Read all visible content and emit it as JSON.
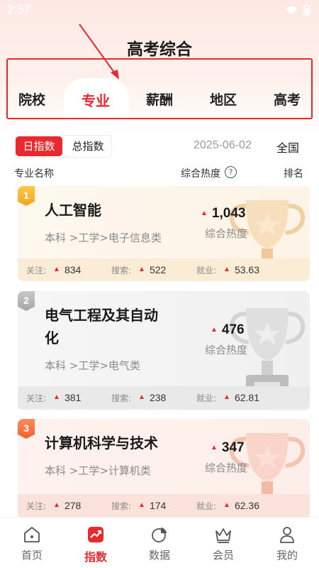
{
  "status_bar": {
    "time": "2:57"
  },
  "header": {
    "title": "高考综合"
  },
  "tabs": [
    {
      "label": "院校",
      "active": false
    },
    {
      "label": "专业",
      "active": true
    },
    {
      "label": "薪酬",
      "active": false
    },
    {
      "label": "地区",
      "active": false
    },
    {
      "label": "高考",
      "active": false
    }
  ],
  "filters": {
    "day_index": "日指数",
    "total_index": "总指数",
    "date": "2025-06-02",
    "region": "全国"
  },
  "table_header": {
    "major_name": "专业名称",
    "heat": "综合热度",
    "help_icon": "?",
    "rank": "排名"
  },
  "rankings": [
    {
      "rank": "1",
      "name": "人工智能",
      "path": "本科 >工学>电子信息类",
      "heat_value": "1,043",
      "heat_label": "综合热度",
      "stats": {
        "follow_label": "关注:",
        "follow": "834",
        "search_label": "搜索:",
        "search": "522",
        "employ_label": "就业:",
        "employ": "53.63"
      }
    },
    {
      "rank": "2",
      "name_line1": "电气工程及其自动",
      "name_line2": "化",
      "path": "本科 >工学>电气类",
      "heat_value": "476",
      "heat_label": "综合热度",
      "stats": {
        "follow_label": "关注:",
        "follow": "381",
        "search_label": "搜索:",
        "search": "238",
        "employ_label": "就业:",
        "employ": "62.81"
      }
    },
    {
      "rank": "3",
      "name": "计算机科学与技术",
      "path": "本科 >工学>计算机类",
      "heat_value": "347",
      "heat_label": "综合热度",
      "stats": {
        "follow_label": "关注:",
        "follow": "278",
        "search_label": "搜索:",
        "search": "174",
        "employ_label": "就业:",
        "employ": "62.36"
      }
    }
  ],
  "bottom_nav": [
    {
      "label": "首页",
      "icon": "home-icon",
      "active": false
    },
    {
      "label": "指数",
      "icon": "trend-chart-icon",
      "active": true
    },
    {
      "label": "数据",
      "icon": "pie-chart-icon",
      "active": false
    },
    {
      "label": "会员",
      "icon": "crown-icon",
      "active": false
    },
    {
      "label": "我的",
      "icon": "user-icon",
      "active": false
    }
  ],
  "colors": {
    "accent": "#e8292f",
    "gold": "#f4a51d",
    "silver": "#a6a6a6",
    "bronze": "#f0622d"
  }
}
